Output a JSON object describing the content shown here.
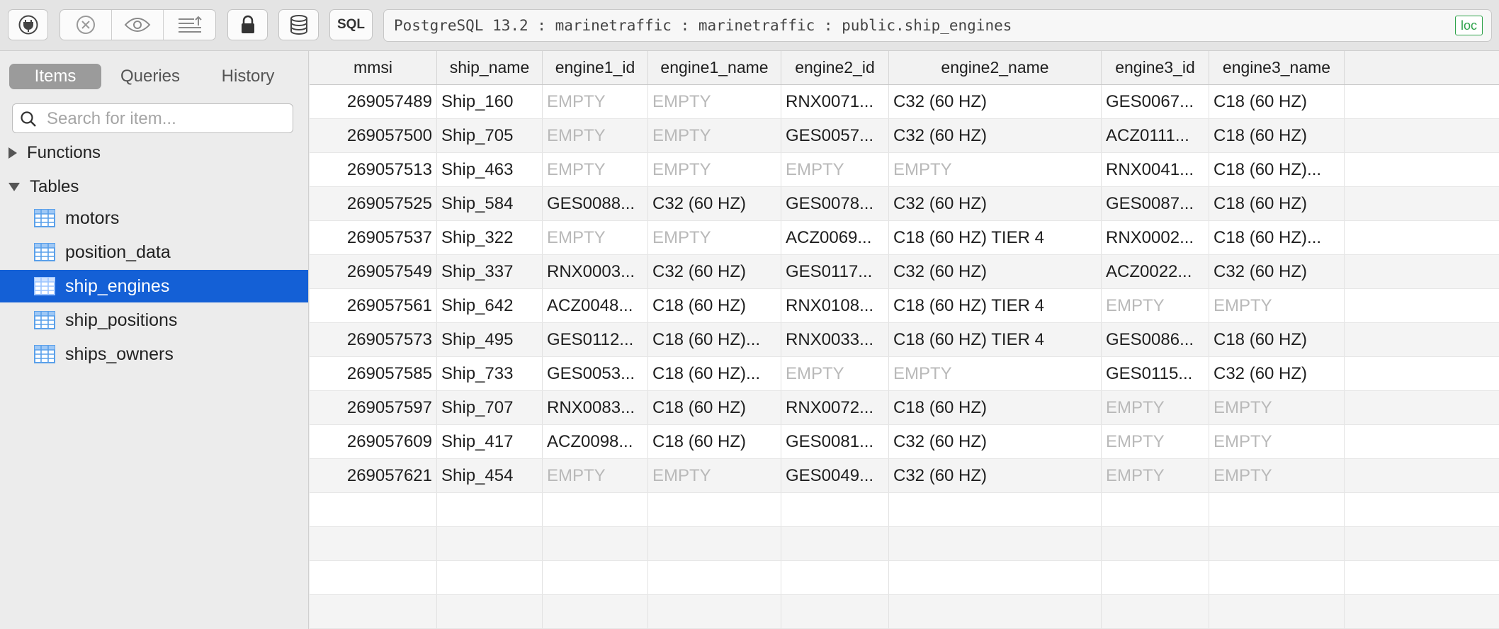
{
  "toolbar": {
    "buttons": [
      {
        "icon": "plug-icon"
      },
      {
        "icon": "close-circle-icon"
      },
      {
        "icon": "eye-icon"
      },
      {
        "icon": "list-upload-icon"
      },
      {
        "icon": "lock-icon"
      },
      {
        "icon": "database-icon"
      }
    ],
    "sql_label": "SQL",
    "connection_text": "PostgreSQL 13.2 : marinetraffic : marinetraffic : public.ship_engines",
    "loc_badge": "loc",
    "accent_green": "#2ea24a"
  },
  "sidebar": {
    "tabs": [
      {
        "label": "Items",
        "active": true
      },
      {
        "label": "Queries",
        "active": false
      },
      {
        "label": "History",
        "active": false
      }
    ],
    "search": {
      "placeholder": "Search for item...",
      "value": ""
    },
    "groups": [
      {
        "label": "Functions",
        "expanded": false
      },
      {
        "label": "Tables",
        "expanded": true
      }
    ],
    "tables": [
      {
        "label": "motors",
        "selected": false
      },
      {
        "label": "position_data",
        "selected": false
      },
      {
        "label": "ship_engines",
        "selected": true
      },
      {
        "label": "ship_positions",
        "selected": false
      },
      {
        "label": "ships_owners",
        "selected": false
      }
    ],
    "selection_color": "#1460d6"
  },
  "grid": {
    "empty_label": "EMPTY",
    "columns": [
      "mmsi",
      "ship_name",
      "engine1_id",
      "engine1_name",
      "engine2_id",
      "engine2_name",
      "engine3_id",
      "engine3_name"
    ],
    "rows": [
      [
        "269057489",
        "Ship_160",
        null,
        null,
        "RNX0071...",
        "C32 (60 HZ)",
        "GES0067...",
        "C18 (60 HZ)"
      ],
      [
        "269057500",
        "Ship_705",
        null,
        null,
        "GES0057...",
        "C32 (60 HZ)",
        "ACZ0111...",
        "C18 (60 HZ)"
      ],
      [
        "269057513",
        "Ship_463",
        null,
        null,
        null,
        null,
        "RNX0041...",
        "C18 (60 HZ)..."
      ],
      [
        "269057525",
        "Ship_584",
        "GES0088...",
        "C32 (60 HZ)",
        "GES0078...",
        "C32 (60 HZ)",
        "GES0087...",
        "C18 (60 HZ)"
      ],
      [
        "269057537",
        "Ship_322",
        null,
        null,
        "ACZ0069...",
        "C18 (60 HZ) TIER 4",
        "RNX0002...",
        "C18 (60 HZ)..."
      ],
      [
        "269057549",
        "Ship_337",
        "RNX0003...",
        "C32 (60 HZ)",
        "GES0117...",
        "C32 (60 HZ)",
        "ACZ0022...",
        "C32 (60 HZ)"
      ],
      [
        "269057561",
        "Ship_642",
        "ACZ0048...",
        "C18 (60 HZ)",
        "RNX0108...",
        "C18 (60 HZ) TIER 4",
        null,
        null
      ],
      [
        "269057573",
        "Ship_495",
        "GES0112...",
        "C18 (60 HZ)...",
        "RNX0033...",
        "C18 (60 HZ) TIER 4",
        "GES0086...",
        "C18 (60 HZ)"
      ],
      [
        "269057585",
        "Ship_733",
        "GES0053...",
        "C18 (60 HZ)...",
        null,
        null,
        "GES0115...",
        "C32 (60 HZ)"
      ],
      [
        "269057597",
        "Ship_707",
        "RNX0083...",
        "C18 (60 HZ)",
        "RNX0072...",
        "C18 (60 HZ)",
        null,
        null
      ],
      [
        "269057609",
        "Ship_417",
        "ACZ0098...",
        "C18 (60 HZ)",
        "GES0081...",
        "C32 (60 HZ)",
        null,
        null
      ],
      [
        "269057621",
        "Ship_454",
        null,
        null,
        "GES0049...",
        "C32 (60 HZ)",
        null,
        null
      ]
    ]
  }
}
